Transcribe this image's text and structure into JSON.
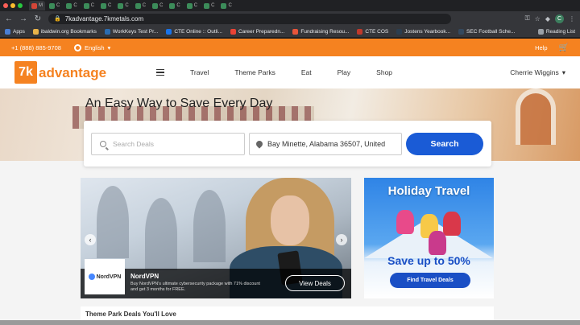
{
  "browser": {
    "tabs": [
      {
        "label": "M",
        "color": "#d44638"
      },
      {
        "label": "C",
        "color": "#3c8c5a"
      },
      {
        "label": "C",
        "color": "#3c8c5a"
      },
      {
        "label": "C",
        "color": "#3c8c5a"
      },
      {
        "label": "C",
        "color": "#3c8c5a"
      },
      {
        "label": "C",
        "color": "#3c8c5a"
      },
      {
        "label": "C",
        "color": "#3c8c5a"
      },
      {
        "label": "C",
        "color": "#3c8c5a"
      },
      {
        "label": "C",
        "color": "#3c8c5a"
      },
      {
        "label": "C",
        "color": "#3c8c5a"
      },
      {
        "label": "C",
        "color": "#3c8c5a"
      },
      {
        "label": "C",
        "color": "#3c8c5a"
      }
    ],
    "url": "7kadvantage.7kmetals.com",
    "profile_initial": "C",
    "bookmarks": [
      {
        "label": "Apps",
        "color": "#4a7fd4"
      },
      {
        "label": "ibaldwin.org Bookmarks",
        "color": "#e8b34a"
      },
      {
        "label": "WorkKeys Test Pr...",
        "color": "#2b6cb0"
      },
      {
        "label": "CTE Online :: Outli...",
        "color": "#1a73e8"
      },
      {
        "label": "Career Preparedn...",
        "color": "#ea4335"
      },
      {
        "label": "Fundraising Resou...",
        "color": "#e8553a"
      },
      {
        "label": "CTE COS",
        "color": "#c0392b"
      },
      {
        "label": "Jostens Yearbook...",
        "color": "#2c3e50"
      },
      {
        "label": "SEC Football Sche...",
        "color": "#34495e"
      }
    ],
    "reading_list": "Reading List"
  },
  "utilbar": {
    "phone": "+1 (888) 885-9708",
    "language": "English",
    "help": "Help"
  },
  "header": {
    "logo_mark": "7k",
    "logo_text": "advantage",
    "nav": [
      "Travel",
      "Theme Parks",
      "Eat",
      "Play",
      "Shop"
    ],
    "user": "Cherrie Wiggins"
  },
  "hero": {
    "title": "An Easy Way to Save Every Day"
  },
  "search": {
    "deals_placeholder": "Search Deals",
    "location_value": "Bay Minette, Alabama 36507, United",
    "button": "Search"
  },
  "carousel": {
    "deal_title": "NordVPN",
    "deal_desc": "Buy NordVPN's ultimate cybersecurity package with 71% discount and get 3 months for FREE.",
    "logo_text": "NordVPN",
    "button": "View Deals"
  },
  "promo": {
    "title": "Holiday Travel",
    "save": "Save up to 50%",
    "button": "Find Travel Deals"
  },
  "section": {
    "title": "Theme Park Deals You'll Love"
  },
  "colors": {
    "brand_orange": "#f58220",
    "search_blue": "#1a5bd6"
  }
}
